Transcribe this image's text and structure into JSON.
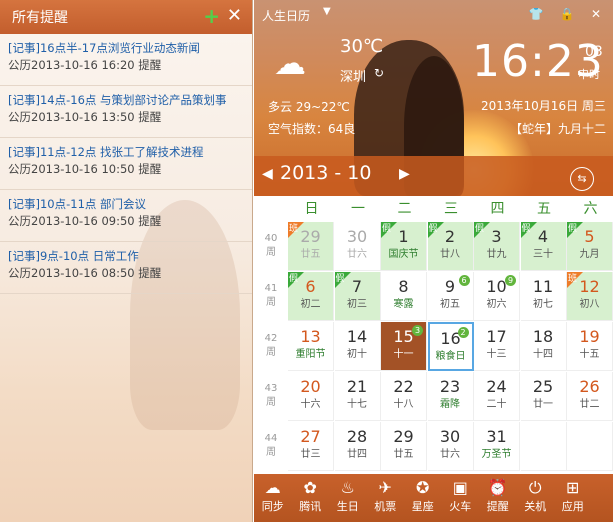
{
  "left": {
    "title": "所有提醒",
    "add_icon": "plus-icon",
    "close_icon": "close-icon",
    "reminders": [
      {
        "title": "[记事]16点半-17点浏览行业动态新闻",
        "date": "公历2013-10-16 16:20 提醒"
      },
      {
        "title": "[记事]14点-16点 与策划部讨论产品策划事",
        "date": "公历2013-10-16 13:50 提醒"
      },
      {
        "title": "[记事]11点-12点 找张工了解技术进程",
        "date": "公历2013-10-16 10:50 提醒"
      },
      {
        "title": "[记事]10点-11点 部门会议",
        "date": "公历2013-10-16 09:50 提醒"
      },
      {
        "title": "[记事]9点-10点 日常工作",
        "date": "公历2013-10-16 08:50 提醒"
      }
    ]
  },
  "right": {
    "app_title": "人生日历",
    "weather": {
      "temp": "30℃",
      "city": "深圳",
      "desc": "多云 29~22℃",
      "air": "空气指数：64良"
    },
    "clock": {
      "time": "16:23",
      "sec": "03",
      "label": "申时"
    },
    "date_line": "2013年10月16日 周三",
    "lunar_line": "【蛇年】九月十二",
    "calendar": {
      "year_month": "2013 - 10",
      "weekdays": [
        "日",
        "一",
        "二",
        "三",
        "四",
        "五",
        "六"
      ],
      "weeks": [
        {
          "num": "40",
          "days": [
            {
              "n": "29",
              "s": "廿五",
              "cls": "gray hol",
              "tag": "班"
            },
            {
              "n": "30",
              "s": "廿六",
              "cls": "gray"
            },
            {
              "n": "1",
              "s": "国庆节",
              "cls": "hol fest",
              "tag": "假"
            },
            {
              "n": "2",
              "s": "廿八",
              "cls": "hol",
              "tag": "假"
            },
            {
              "n": "3",
              "s": "廿九",
              "cls": "hol",
              "tag": "假"
            },
            {
              "n": "4",
              "s": "三十",
              "cls": "hol",
              "tag": "假"
            },
            {
              "n": "5",
              "s": "九月",
              "cls": "hol red",
              "tag": "假"
            }
          ]
        },
        {
          "num": "41",
          "days": [
            {
              "n": "6",
              "s": "初二",
              "cls": "hol red",
              "tag": "假"
            },
            {
              "n": "7",
              "s": "初三",
              "cls": "hol",
              "tag": "假"
            },
            {
              "n": "8",
              "s": "寒露",
              "cls": "fest"
            },
            {
              "n": "9",
              "s": "初五",
              "badge": "6"
            },
            {
              "n": "10",
              "s": "初六",
              "badge": "9"
            },
            {
              "n": "11",
              "s": "初七"
            },
            {
              "n": "12",
              "s": "初八",
              "cls": "hol red",
              "tag": "班"
            }
          ]
        },
        {
          "num": "42",
          "days": [
            {
              "n": "13",
              "s": "重阳节",
              "cls": "red fest"
            },
            {
              "n": "14",
              "s": "初十"
            },
            {
              "n": "15",
              "s": "十一",
              "cls": "sel",
              "badge": "3"
            },
            {
              "n": "16",
              "s": "粮食日",
              "cls": "today fest",
              "badge": "2"
            },
            {
              "n": "17",
              "s": "十三"
            },
            {
              "n": "18",
              "s": "十四"
            },
            {
              "n": "19",
              "s": "十五",
              "cls": "red"
            }
          ]
        },
        {
          "num": "43",
          "days": [
            {
              "n": "20",
              "s": "十六",
              "cls": "red"
            },
            {
              "n": "21",
              "s": "十七"
            },
            {
              "n": "22",
              "s": "十八"
            },
            {
              "n": "23",
              "s": "霜降",
              "cls": "fest"
            },
            {
              "n": "24",
              "s": "二十"
            },
            {
              "n": "25",
              "s": "廿一"
            },
            {
              "n": "26",
              "s": "廿二",
              "cls": "red"
            }
          ]
        },
        {
          "num": "44",
          "days": [
            {
              "n": "27",
              "s": "廿三",
              "cls": "red"
            },
            {
              "n": "28",
              "s": "廿四"
            },
            {
              "n": "29",
              "s": "廿五"
            },
            {
              "n": "30",
              "s": "廿六"
            },
            {
              "n": "31",
              "s": "万圣节",
              "cls": "fest"
            },
            {
              "n": "",
              "s": ""
            },
            {
              "n": "",
              "s": ""
            }
          ]
        }
      ],
      "week_label": "周"
    },
    "toolbar": [
      {
        "label": "同步",
        "icon": "cloud-icon",
        "glyph": "☁"
      },
      {
        "label": "腾讯",
        "icon": "qq-icon",
        "glyph": "✿"
      },
      {
        "label": "生日",
        "icon": "cake-icon",
        "glyph": "♨"
      },
      {
        "label": "机票",
        "icon": "plane-icon",
        "glyph": "✈"
      },
      {
        "label": "星座",
        "icon": "star-icon",
        "glyph": "✪"
      },
      {
        "label": "火车",
        "icon": "train-icon",
        "glyph": "▣"
      },
      {
        "label": "提醒",
        "icon": "alarm-icon",
        "glyph": "⏰"
      },
      {
        "label": "关机",
        "icon": "power-icon",
        "glyph": "⏻"
      },
      {
        "label": "应用",
        "icon": "apps-icon",
        "glyph": "⊞"
      }
    ]
  }
}
